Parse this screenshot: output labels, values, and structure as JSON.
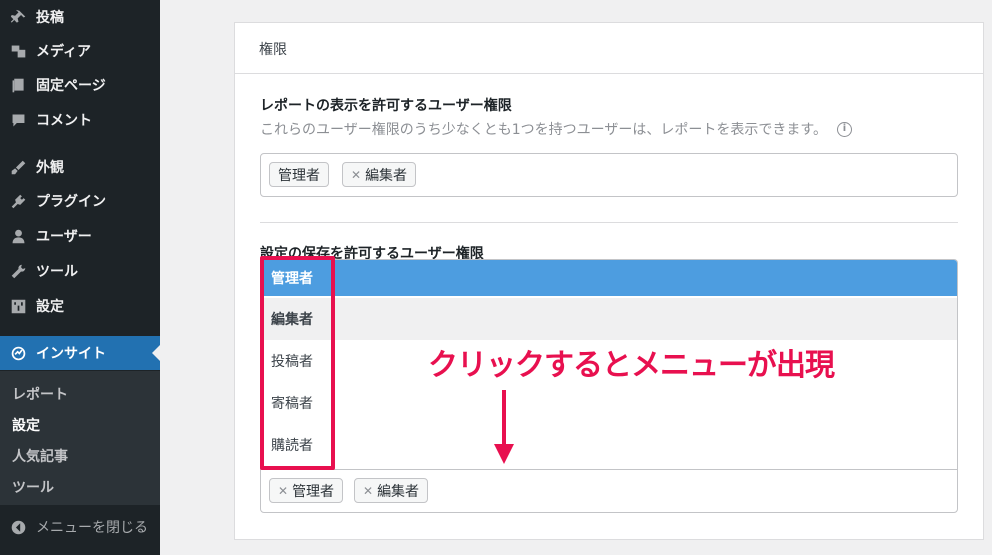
{
  "sidebar": {
    "items": [
      {
        "label": "投稿",
        "icon": "pin-icon"
      },
      {
        "label": "メディア",
        "icon": "media-icon"
      },
      {
        "label": "固定ページ",
        "icon": "page-icon"
      },
      {
        "label": "コメント",
        "icon": "comment-icon"
      },
      {
        "label": "外観",
        "icon": "brush-icon"
      },
      {
        "label": "プラグイン",
        "icon": "plugin-icon"
      },
      {
        "label": "ユーザー",
        "icon": "user-icon"
      },
      {
        "label": "ツール",
        "icon": "wrench-icon"
      },
      {
        "label": "設定",
        "icon": "settings-icon"
      },
      {
        "label": "インサイト",
        "icon": "insights-icon"
      }
    ],
    "submenu": [
      "レポート",
      "設定",
      "人気記事",
      "ツール"
    ],
    "collapse_label": "メニューを閉じる"
  },
  "panel": {
    "header": "権限",
    "report_section": {
      "title": "レポートの表示を許可するユーザー権限",
      "description": "これらのユーザー権限のうち少なくとも1つを持つユーザーは、レポートを表示できます。",
      "tags": [
        "管理者",
        "編集者"
      ]
    },
    "save_section": {
      "title": "設定の保存を許可するユーザー権限",
      "options": [
        "管理者",
        "編集者",
        "投稿者",
        "寄稿者",
        "購読者"
      ],
      "tags": [
        "管理者",
        "編集者"
      ]
    }
  },
  "annotation": {
    "text": "クリックするとメニューが出現",
    "color": "#e8104f"
  },
  "colors": {
    "sidebar_bg": "#1d2327",
    "active_menu": "#2271b1",
    "highlight_option": "#4d9de0"
  }
}
